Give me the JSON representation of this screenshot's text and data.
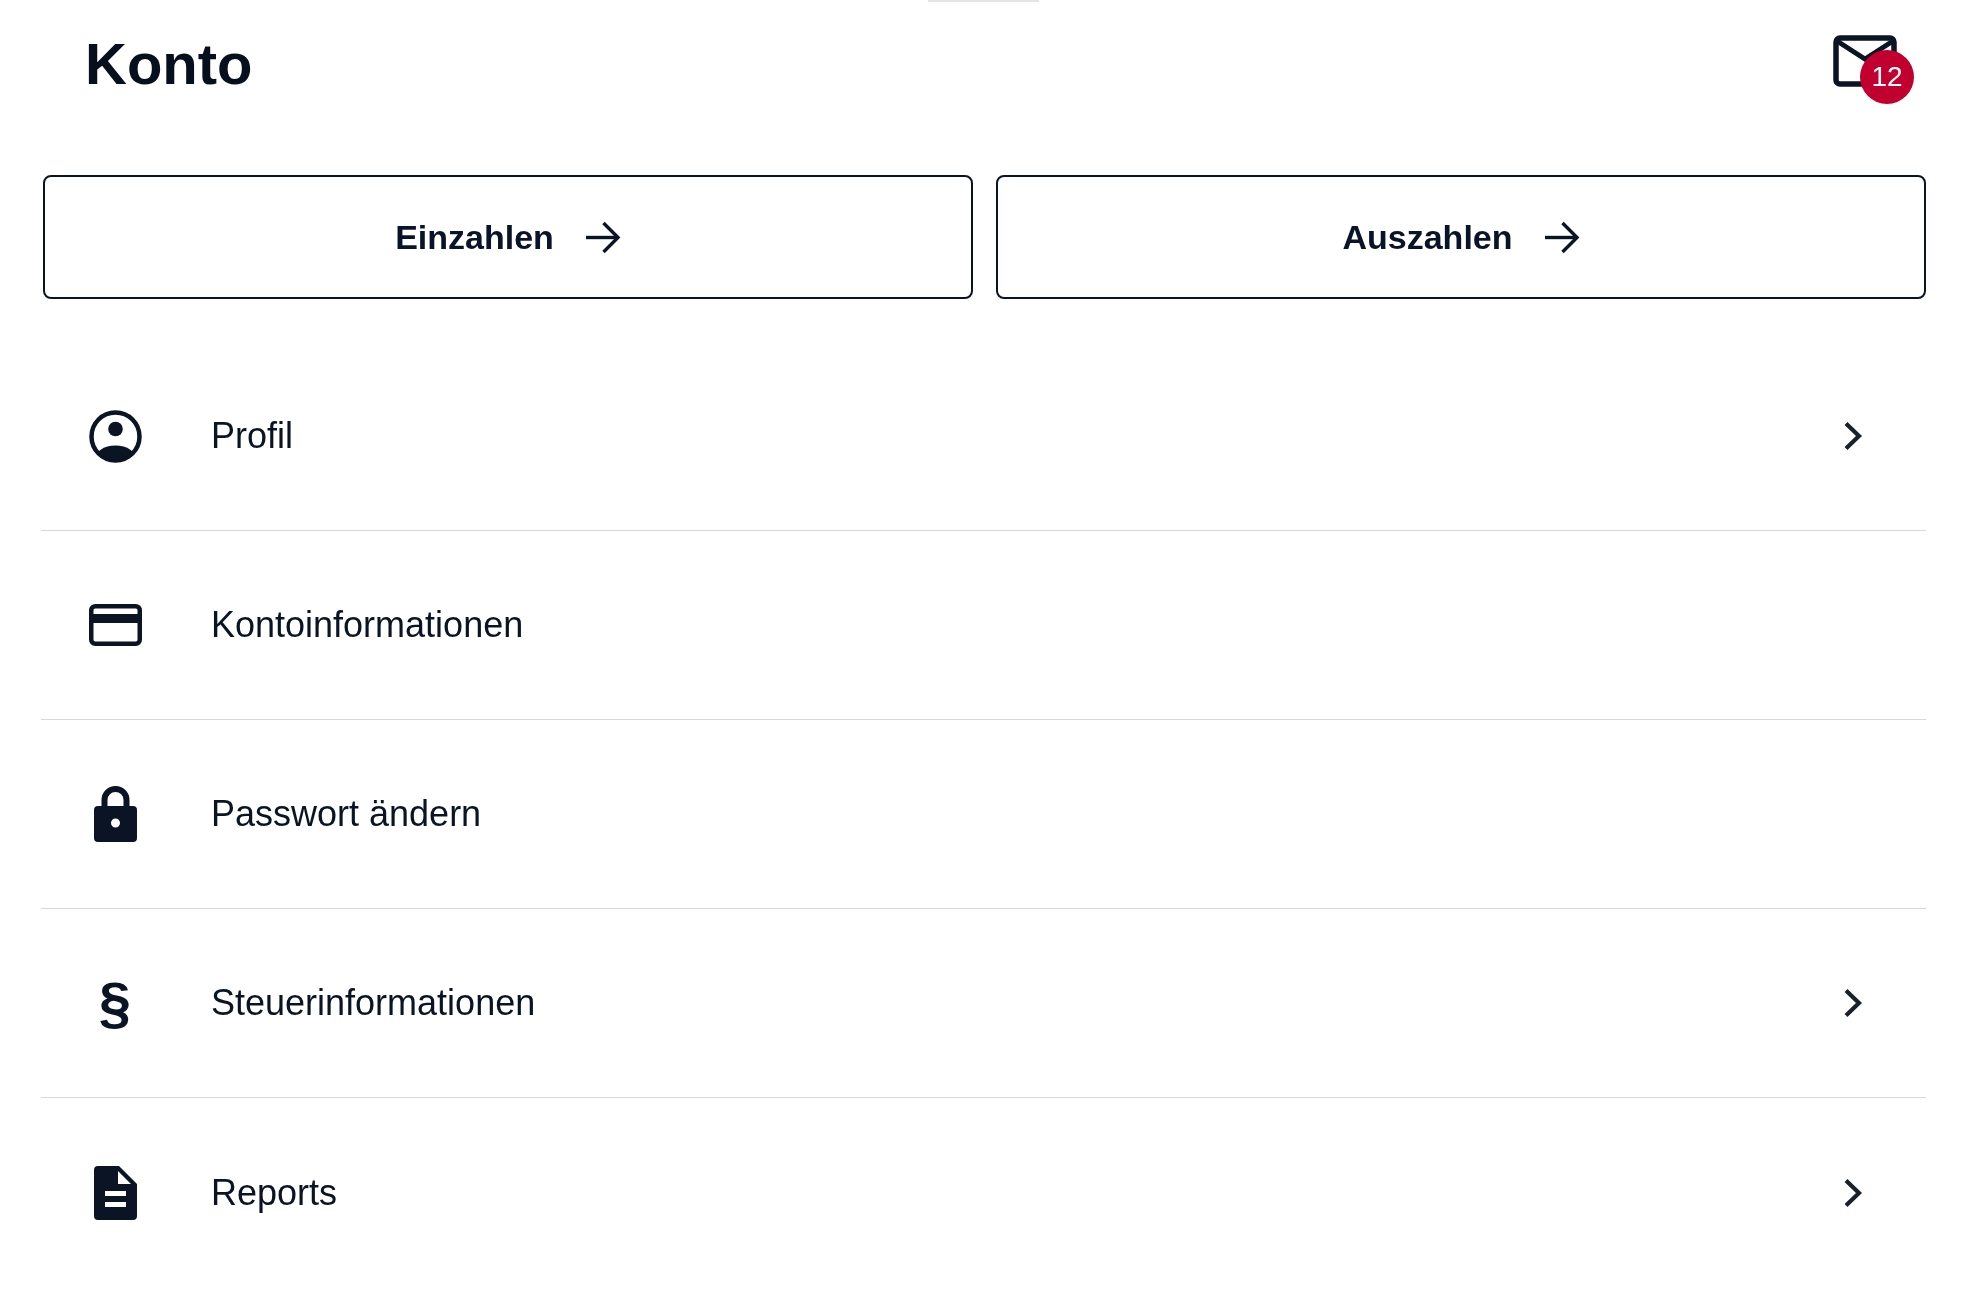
{
  "header": {
    "title": "Konto",
    "messages": {
      "unread": "12"
    }
  },
  "actions": [
    {
      "label": "Einzahlen"
    },
    {
      "label": "Auszahlen"
    }
  ],
  "menu": [
    {
      "label": "Profil",
      "chevron": true
    },
    {
      "label": "Kontoinformationen",
      "chevron": false
    },
    {
      "label": "Passwort ändern",
      "chevron": false
    },
    {
      "symbol": "§",
      "label": "Steuerinformationen",
      "chevron": true
    },
    {
      "label": "Reports",
      "chevron": true
    }
  ]
}
